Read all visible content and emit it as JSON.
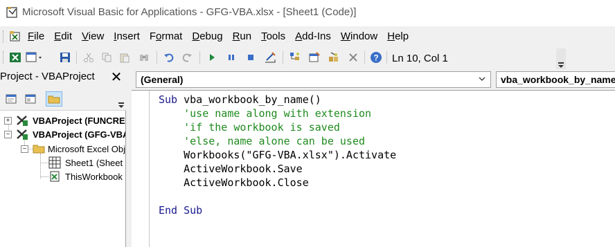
{
  "window": {
    "title": "Microsoft Visual Basic for Applications - GFG-VBA.xlsx - [Sheet1 (Code)]"
  },
  "menu": {
    "items": [
      {
        "label": "File",
        "accel": "F"
      },
      {
        "label": "Edit",
        "accel": "E"
      },
      {
        "label": "View",
        "accel": "V"
      },
      {
        "label": "Insert",
        "accel": "I"
      },
      {
        "label": "Format",
        "accel": "o"
      },
      {
        "label": "Debug",
        "accel": "D"
      },
      {
        "label": "Run",
        "accel": "R"
      },
      {
        "label": "Tools",
        "accel": "T"
      },
      {
        "label": "Add-Ins",
        "accel": "A"
      },
      {
        "label": "Window",
        "accel": "W"
      },
      {
        "label": "Help",
        "accel": "H"
      }
    ]
  },
  "toolbar": {
    "cursor_position": "Ln 10, Col 1",
    "icons": [
      "excel-icon",
      "insert-module-icon",
      "save-icon",
      "cut-icon",
      "copy-icon",
      "paste-icon",
      "find-icon",
      "undo-icon",
      "redo-icon",
      "run-icon",
      "break-icon",
      "reset-icon",
      "design-mode-icon",
      "project-explorer-icon",
      "properties-icon",
      "object-browser-icon",
      "toolbox-icon",
      "help-icon"
    ]
  },
  "project": {
    "title": "Project - VBAProject",
    "close_label": "✕",
    "tree": [
      {
        "label": "VBAProject (FUNCRE",
        "bold": true,
        "expander": "+"
      },
      {
        "label": "VBAProject (GFG-VBA",
        "bold": true,
        "expander": "−"
      },
      {
        "label": "Microsoft Excel Obj",
        "bold": false,
        "expander": "−"
      },
      {
        "label": "Sheet1 (Sheet",
        "bold": false,
        "expander": ""
      },
      {
        "label": "ThisWorkbook",
        "bold": false,
        "expander": ""
      }
    ]
  },
  "code": {
    "object_combo": "(General)",
    "procedure_combo": "vba_workbook_by_name",
    "lines": [
      [
        {
          "t": "Sub ",
          "c": "kw"
        },
        {
          "t": "vba_workbook_by_name()",
          "c": "tx"
        }
      ],
      [
        {
          "t": "    'use name along with extension",
          "c": "cm"
        }
      ],
      [
        {
          "t": "    'if the workbook is saved",
          "c": "cm"
        }
      ],
      [
        {
          "t": "    'else, name alone can be used",
          "c": "cm"
        }
      ],
      [
        {
          "t": "    Workbooks(\"GFG-VBA.xlsx\").Activate",
          "c": "tx"
        }
      ],
      [
        {
          "t": "    ActiveWorkbook.Save",
          "c": "tx"
        }
      ],
      [
        {
          "t": "    ActiveWorkbook.Close",
          "c": "tx"
        }
      ],
      [
        {
          "t": "",
          "c": "tx"
        }
      ],
      [
        {
          "t": "End Sub",
          "c": "kw"
        }
      ]
    ]
  }
}
